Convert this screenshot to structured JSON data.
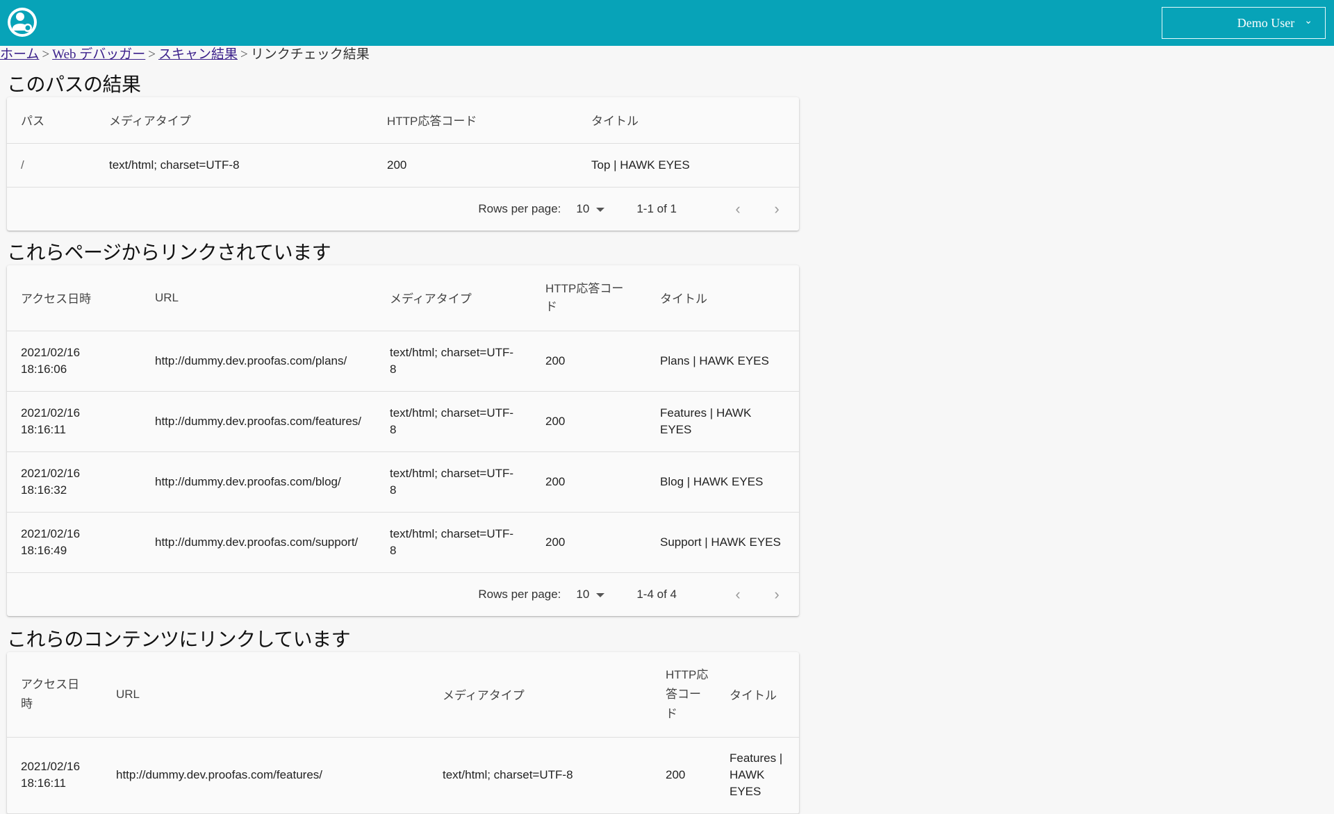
{
  "header": {
    "user_label": "Demo User",
    "accent": "#07a3b8",
    "logo_icon": "user-circle-logo-icon"
  },
  "breadcrumb": {
    "home": "ホーム",
    "web_debugger": "Web デバッガー",
    "scan_results": "スキャン結果",
    "current": "リンクチェック結果",
    "separator": ">"
  },
  "path_section": {
    "title": "このパスの結果",
    "columns": [
      "パス",
      "メディアタイプ",
      "HTTP応答コード",
      "タイトル"
    ],
    "rows": [
      [
        "/",
        "text/html; charset=UTF-8",
        "200",
        "Top | HAWK EYES"
      ]
    ],
    "pager": {
      "rows_label": "Rows per page:",
      "rows_value": "10",
      "range": "1-1 of 1"
    }
  },
  "linked_from_section": {
    "title": "これらページからリンクされています",
    "columns": [
      "アクセス日時",
      "URL",
      "メディアタイプ",
      "HTTP応答コード",
      "タイトル"
    ],
    "rows": [
      [
        "2021/02/16 18:16:06",
        "http://dummy.dev.proofas.com/plans/",
        "text/html; charset=UTF-8",
        "200",
        "Plans | HAWK EYES"
      ],
      [
        "2021/02/16 18:16:11",
        "http://dummy.dev.proofas.com/features/",
        "text/html; charset=UTF-8",
        "200",
        "Features | HAWK EYES"
      ],
      [
        "2021/02/16 18:16:32",
        "http://dummy.dev.proofas.com/blog/",
        "text/html; charset=UTF-8",
        "200",
        "Blog | HAWK EYES"
      ],
      [
        "2021/02/16 18:16:49",
        "http://dummy.dev.proofas.com/support/",
        "text/html; charset=UTF-8",
        "200",
        "Support | HAWK EYES"
      ]
    ],
    "pager": {
      "rows_label": "Rows per page:",
      "rows_value": "10",
      "range": "1-4 of 4"
    }
  },
  "links_to_section": {
    "title": "これらのコンテンツにリンクしています",
    "columns": [
      "アクセス日時",
      "URL",
      "メディアタイプ",
      "HTTP応答コード",
      "タイトル"
    ],
    "rows": [
      [
        "2021/02/16 18:16:11",
        "http://dummy.dev.proofas.com/features/",
        "text/html; charset=UTF-8",
        "200",
        "Features | HAWK EYES"
      ]
    ]
  }
}
